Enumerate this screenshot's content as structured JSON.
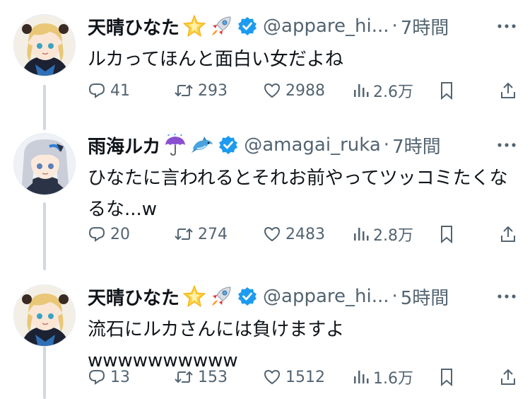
{
  "tweets": [
    {
      "display_name": "天晴ひなた",
      "name_emojis": [
        "star-emoji",
        "rocket-emoji"
      ],
      "handle": "@appare_hi...",
      "separator": "·",
      "time": "7時間",
      "text": "ルカってほんと面白い女だよね",
      "replies": "41",
      "retweets": "293",
      "likes": "2988",
      "views": "2.6万"
    },
    {
      "display_name": "雨海ルカ",
      "name_emojis": [
        "umbrella-rain-emoji",
        "dolphin-emoji"
      ],
      "handle": "@amagai_ruka",
      "separator": "·",
      "time": "7時間",
      "text": "ひなたに言われるとそれお前やってツッコミたくなるな...w",
      "replies": "20",
      "retweets": "274",
      "likes": "2483",
      "views": "2.8万"
    },
    {
      "display_name": "天晴ひなた",
      "name_emojis": [
        "star-emoji",
        "rocket-emoji"
      ],
      "handle": "@appare_hi...",
      "separator": "·",
      "time": "5時間",
      "text": "流石にルカさんには負けますよ\nwwwwwwwwww",
      "replies": "13",
      "retweets": "153",
      "likes": "1512",
      "views": "1.6万"
    }
  ],
  "colors": {
    "text": "#0f1419",
    "secondary": "#536471",
    "verified": "#1d9bf0",
    "thread_line": "#cfd9de"
  },
  "icons": [
    "reply-icon",
    "retweet-icon",
    "like-icon",
    "views-icon",
    "bookmark-icon",
    "share-icon",
    "more-icon",
    "verified-badge-icon"
  ]
}
